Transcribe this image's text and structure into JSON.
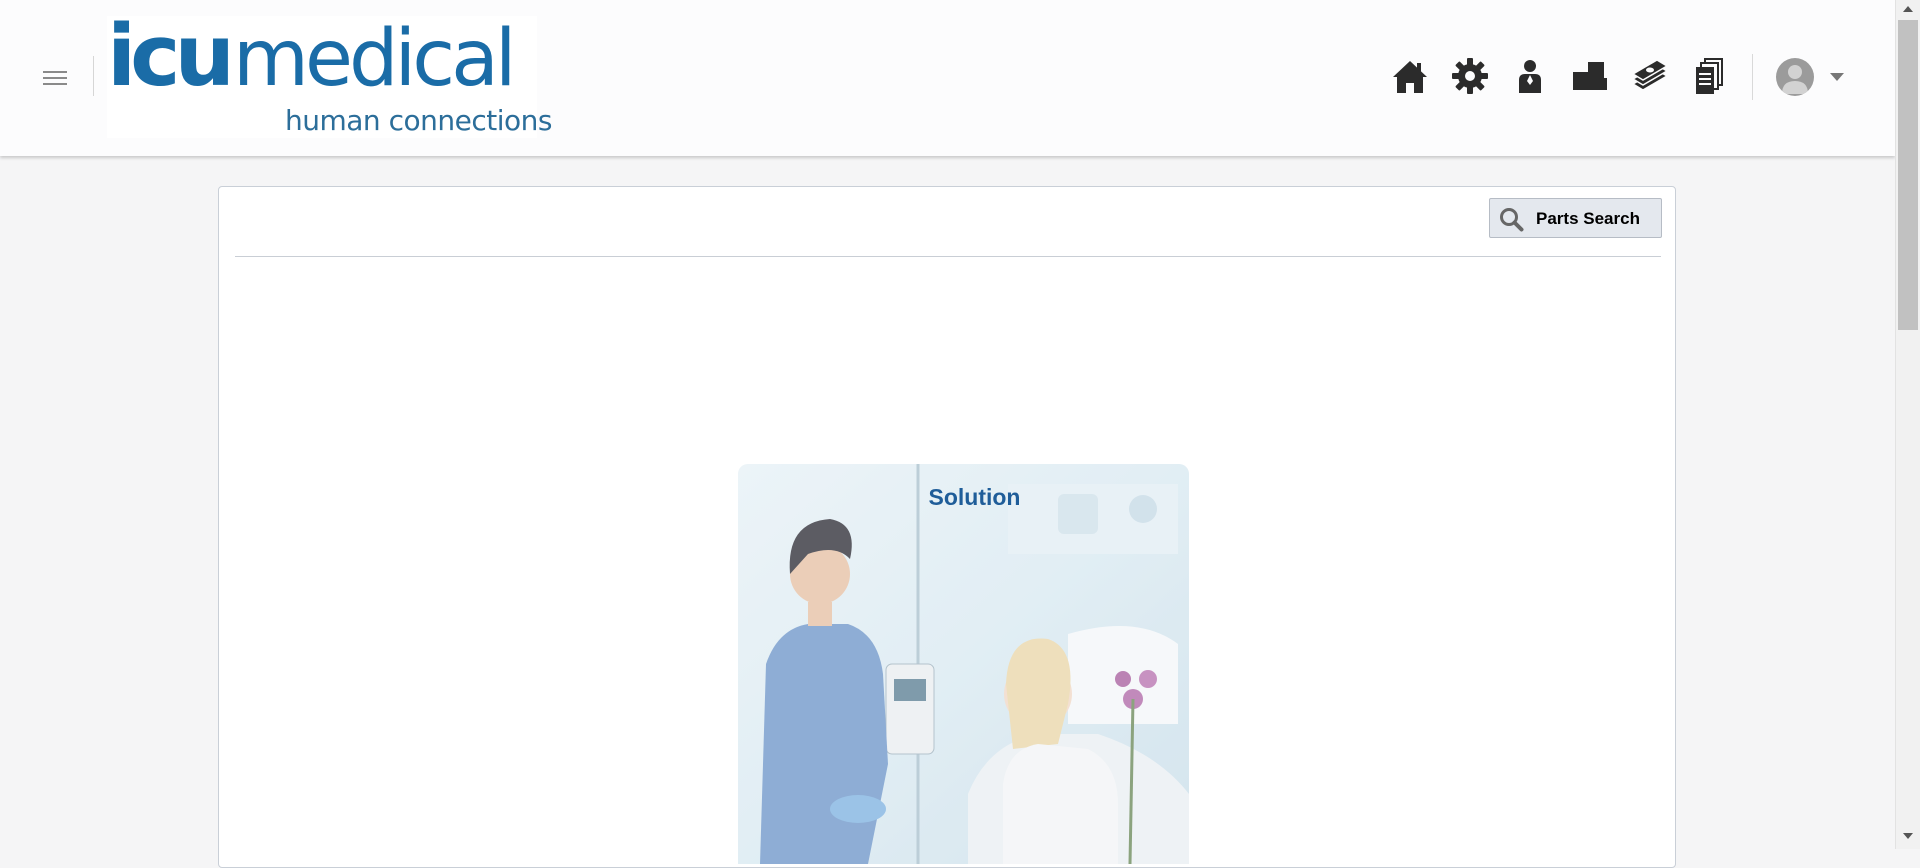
{
  "header": {
    "logo": {
      "primary_bold": "icu",
      "primary_light": "medical",
      "tagline": "human connections",
      "color": "#1a6ca7"
    },
    "menu_icon": "hamburger-menu-icon",
    "nav_icons": [
      "home-icon",
      "gear-icon",
      "person-icon",
      "boxes-icon",
      "money-icon",
      "documents-icon"
    ],
    "user_menu": {
      "avatar_icon": "user-avatar-icon",
      "caret_icon": "caret-down-icon"
    }
  },
  "toolbar": {
    "parts_search_label": "Parts Search",
    "parts_search_icon": "search-icon"
  },
  "tiles": [
    {
      "title": "Solution",
      "title_color": "#1f5d99"
    }
  ],
  "colors": {
    "page_bg": "#f5f5f6",
    "header_bg": "#fcfcfd",
    "panel_border": "#c9cfd7",
    "button_bg": "#e4e8ee"
  }
}
